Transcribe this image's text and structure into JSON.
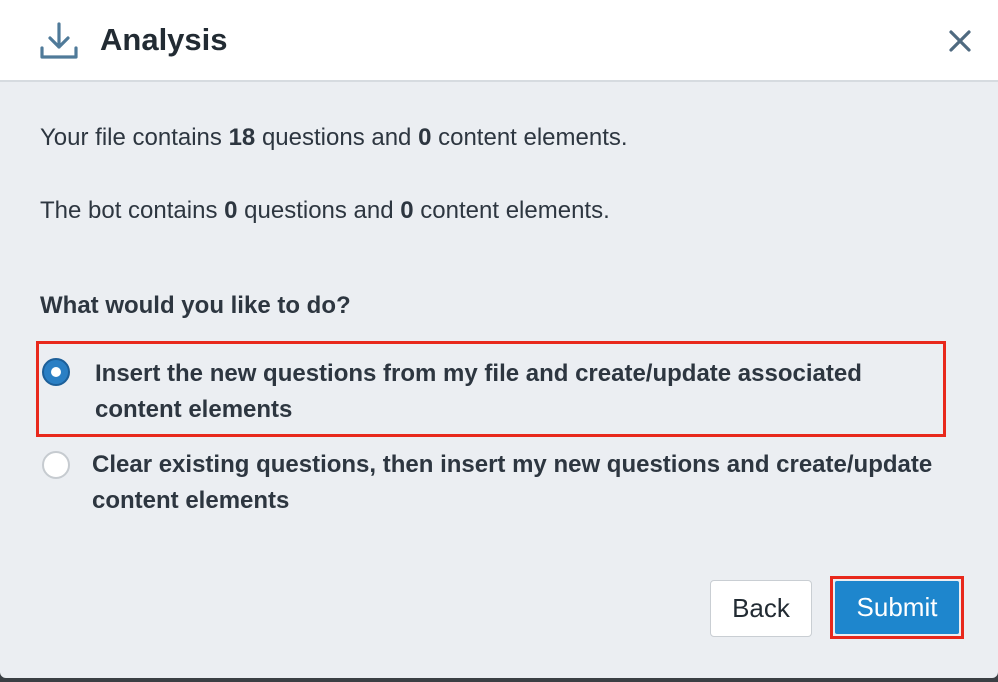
{
  "dialog": {
    "title": "Analysis",
    "header_icon": "download-icon",
    "close_icon": "close-icon"
  },
  "file_summary": {
    "prefix": "Your file contains ",
    "questions_count": "18",
    "middle": " questions and ",
    "content_count": "0",
    "suffix": " content elements."
  },
  "bot_summary": {
    "prefix": "The bot contains ",
    "questions_count": "0",
    "middle": " questions and ",
    "content_count": "0",
    "suffix": " content elements."
  },
  "question": "What would you like to do?",
  "options": [
    {
      "label": "Insert the new questions from my file and create/update associated content elements",
      "selected": true
    },
    {
      "label": "Clear existing questions, then insert my new questions and create/update content elements",
      "selected": false
    }
  ],
  "buttons": {
    "back": "Back",
    "submit": "Submit"
  },
  "colors": {
    "accent": "#1e86cd",
    "highlight": "#e8281c",
    "background": "#ebeef2"
  }
}
